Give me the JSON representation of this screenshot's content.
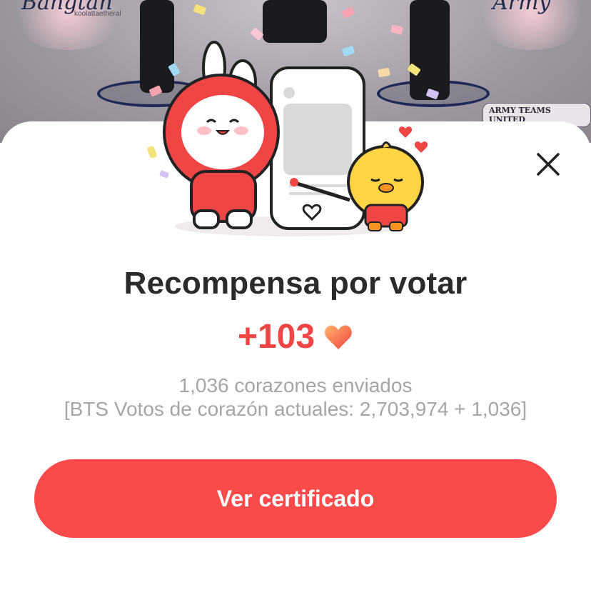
{
  "banner": {
    "left_script": "Bangtan",
    "left_caption": "koolattaetheral",
    "right_script": "Army",
    "badge": "ARMY TEAMS UNITED"
  },
  "dialog": {
    "close_icon": "close-icon",
    "title": "Recompensa por votar",
    "reward_amount": "+103",
    "reward_icon": "heart-icon",
    "hearts_sent": "1,036 corazones enviados",
    "vote_summary": "[BTS Votos de corazón actuales: 2,703,974 + 1,036]",
    "cta_label": "Ver certificado"
  },
  "colors": {
    "accent": "#fb4a4a",
    "reward_text": "#f04545",
    "title_text": "#2b2b2b",
    "muted_text": "#a6a6a6"
  }
}
